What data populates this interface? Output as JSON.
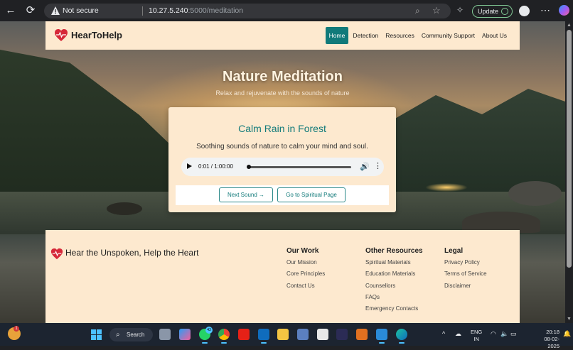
{
  "browser": {
    "security_label": "Not secure",
    "url_host": "10.27.5.240",
    "url_path": ":5000/meditation",
    "update_label": "Update"
  },
  "site": {
    "brand": "HearToHelp",
    "nav": [
      {
        "label": "Home",
        "active": true
      },
      {
        "label": "Detection"
      },
      {
        "label": "Resources"
      },
      {
        "label": "Community Support"
      },
      {
        "label": "About Us"
      }
    ]
  },
  "hero": {
    "title": "Nature Meditation",
    "subtitle": "Relax and rejuvenate with the sounds of nature"
  },
  "card": {
    "title": "Calm Rain in Forest",
    "description": "Soothing sounds of nature to calm your mind and soul.",
    "audio_time": "0:01 / 1:00:00",
    "next_button": "Next Sound →",
    "spiritual_button": "Go to Spiritual Page"
  },
  "footer": {
    "tagline": "Hear the Unspoken, Help the Heart",
    "columns": [
      {
        "title": "Our Work",
        "links": [
          "Our Mission",
          "Core Principles",
          "Contact Us"
        ]
      },
      {
        "title": "Other Resources",
        "links": [
          "Spiritual Materials",
          "Education Materials",
          "Counsellors",
          "FAQs",
          "Emergency Contacts"
        ]
      },
      {
        "title": "Legal",
        "links": [
          "Privacy Policy",
          "Terms of Service",
          "Disclaimer"
        ]
      }
    ]
  },
  "taskbar": {
    "search_label": "Search",
    "notification_count": "1",
    "whatsapp_count": "43",
    "lang_line1": "ENG",
    "lang_line2": "IN",
    "time": "20:18",
    "date": "08-02-2025"
  },
  "colors": {
    "accent": "#117a7a",
    "cream": "#fde9cf"
  }
}
